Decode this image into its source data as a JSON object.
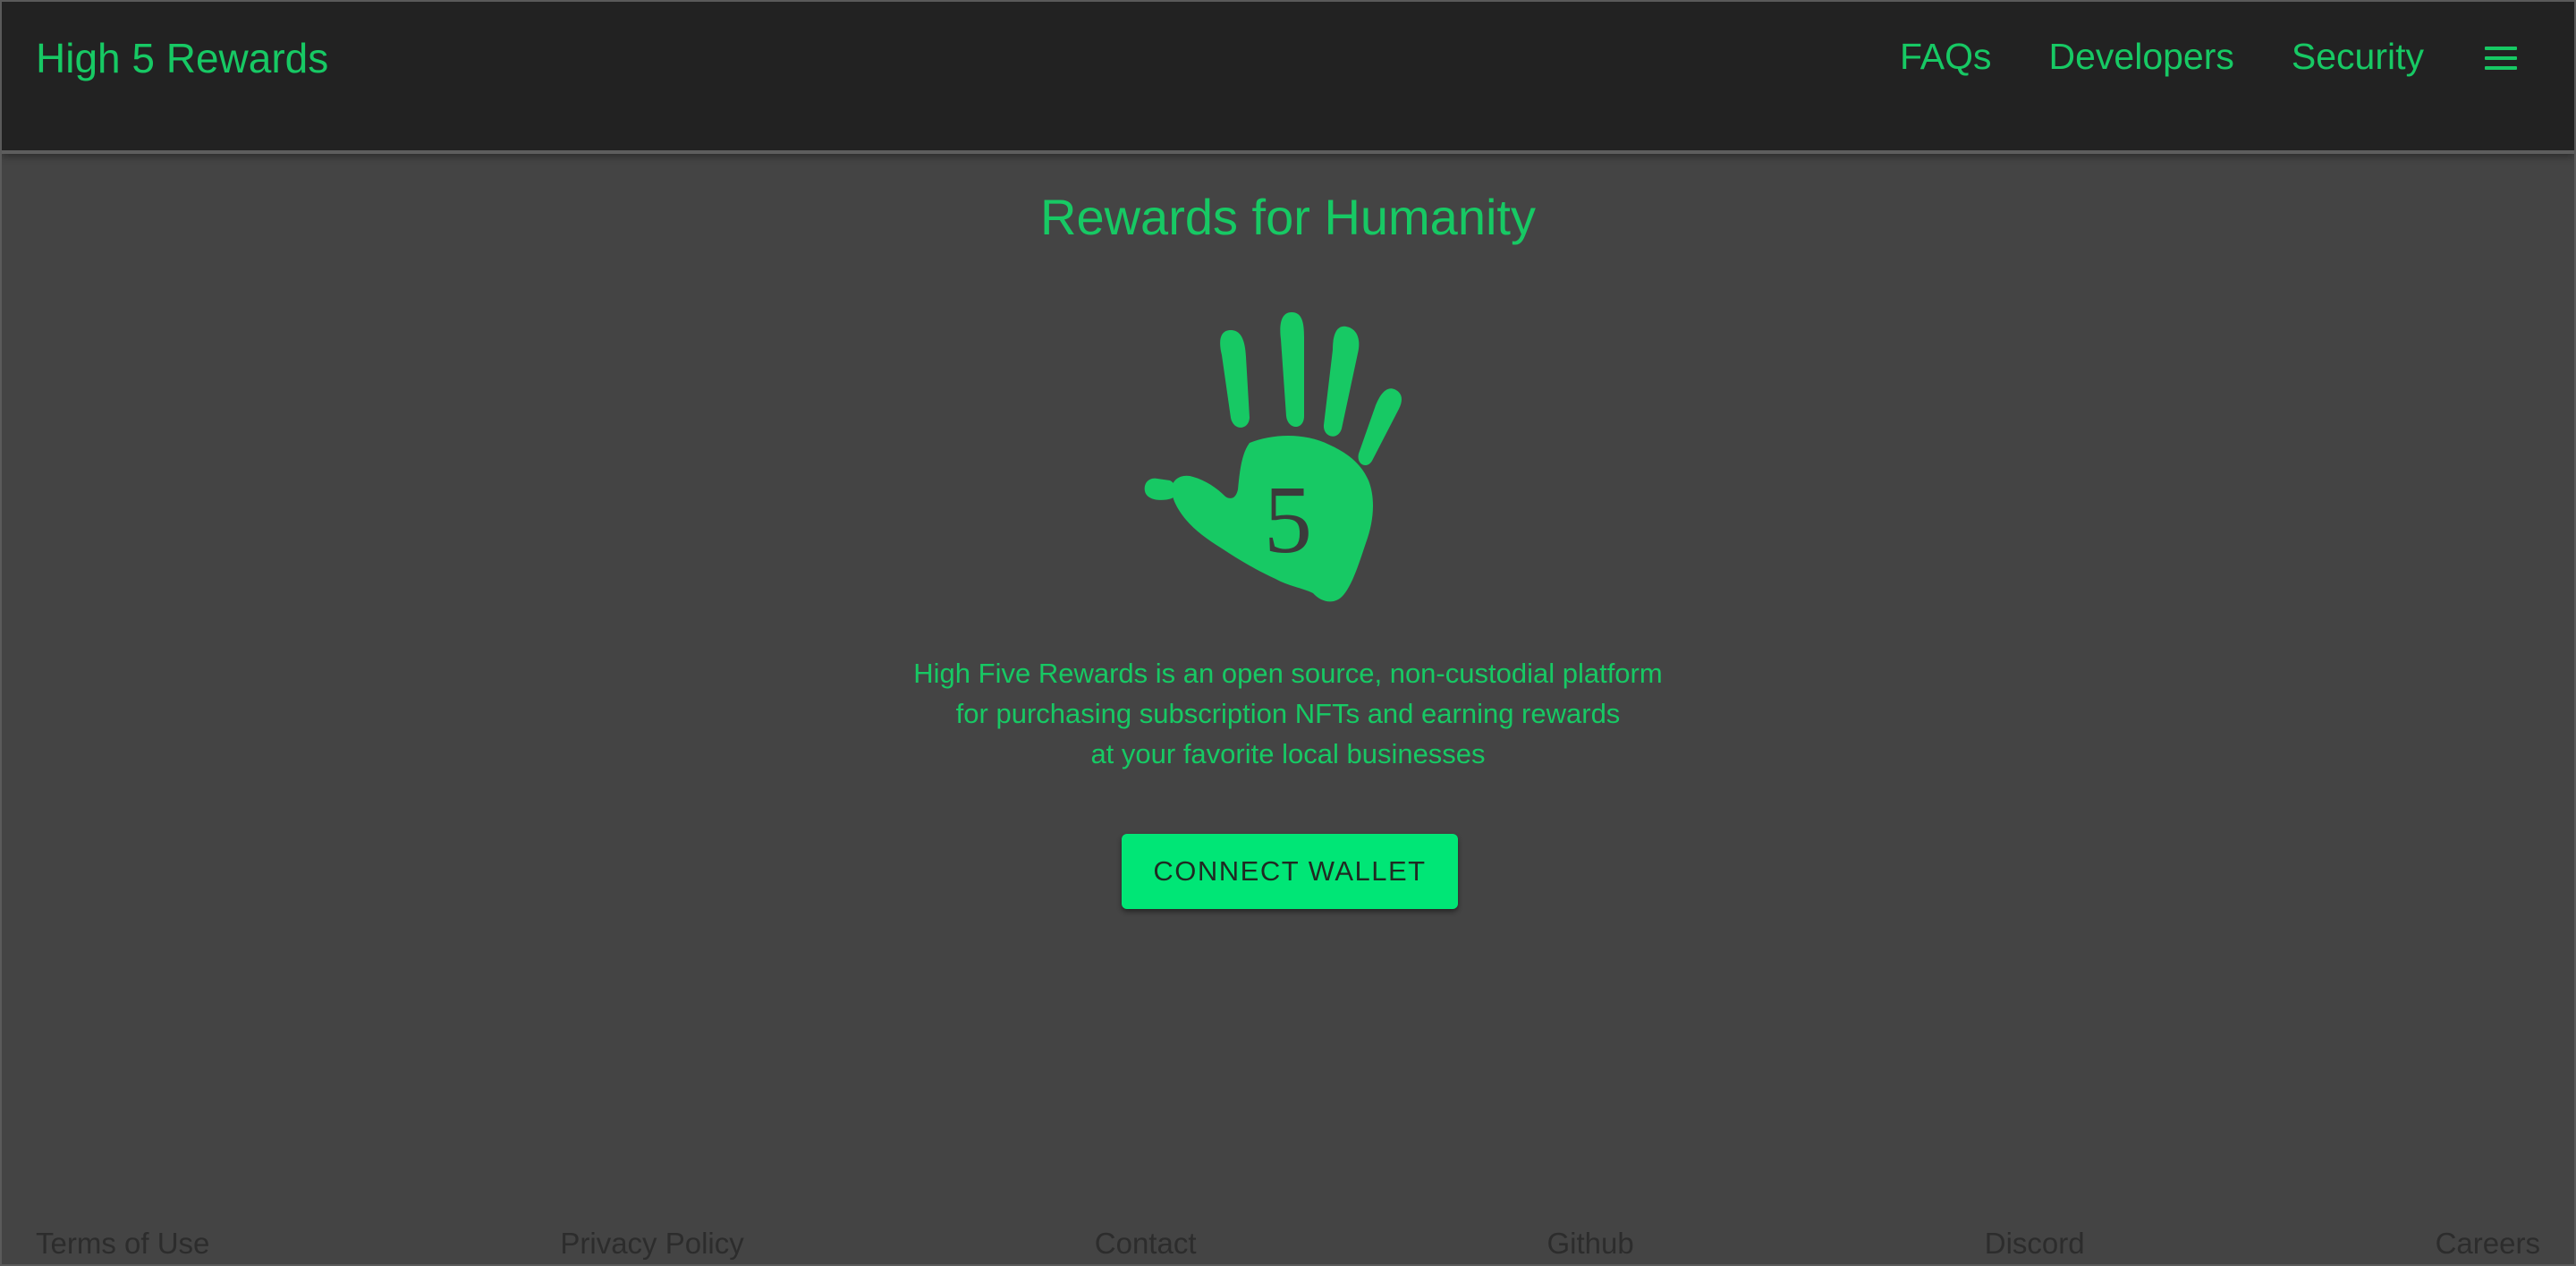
{
  "colors": {
    "accent": "#17c964",
    "button": "#00e676",
    "header_bg": "#222222",
    "page_bg": "#444444",
    "footer_text": "#2c2c2c"
  },
  "header": {
    "brand": "High 5 Rewards",
    "nav": [
      {
        "label": "FAQs"
      },
      {
        "label": "Developers"
      },
      {
        "label": "Security"
      }
    ],
    "menu_icon": "hamburger-menu-icon"
  },
  "hero": {
    "title": "Rewards for Humanity",
    "logo_icon": "hand-five-icon",
    "logo_number": "5",
    "description_lines": [
      "High Five Rewards is an open source, non-custodial platform",
      "for purchasing subscription NFTs and earning rewards",
      "at your favorite local businesses"
    ],
    "cta_label": "CONNECT WALLET"
  },
  "footer": {
    "links": [
      {
        "label": "Terms of Use"
      },
      {
        "label": "Privacy Policy"
      },
      {
        "label": "Contact"
      },
      {
        "label": "Github"
      },
      {
        "label": "Discord"
      },
      {
        "label": "Careers"
      }
    ]
  }
}
